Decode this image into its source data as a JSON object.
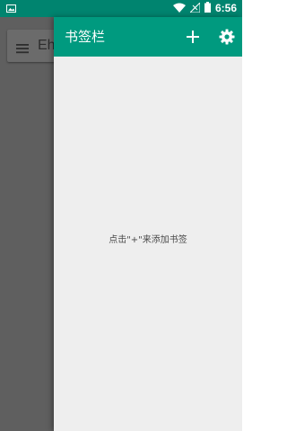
{
  "status_bar": {
    "time": "6:56",
    "icons": [
      "image-notification-icon",
      "wifi-icon",
      "cellular-signal-icon",
      "battery-icon"
    ]
  },
  "background": {
    "search_text": "Eh"
  },
  "drawer": {
    "title": "书签栏",
    "empty_hint": "点击\"+\"来添加书签"
  },
  "colors": {
    "status_bar": "#00846f",
    "toolbar": "#009a7f",
    "drawer_bg": "#eeeeee",
    "scrim": "#5f5f5f"
  }
}
